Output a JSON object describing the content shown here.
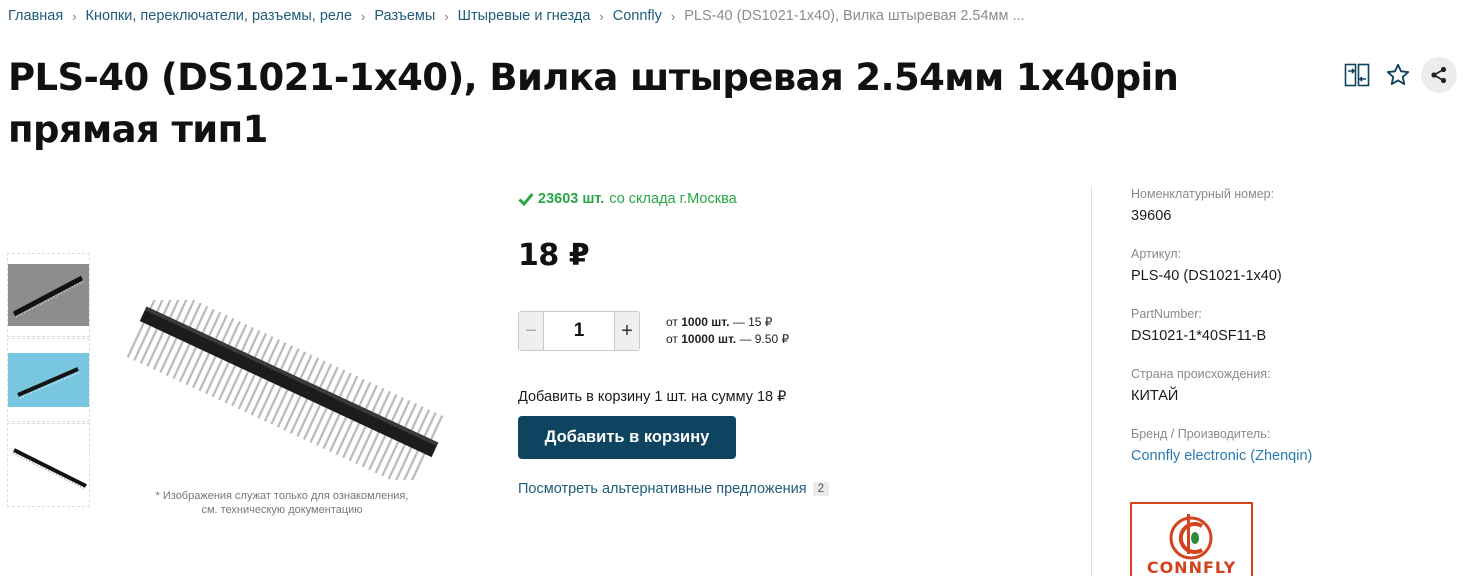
{
  "breadcrumb": {
    "items": [
      "Главная",
      "Кнопки, переключатели, разъемы, реле",
      "Разъемы",
      "Штыревые и гнезда",
      "Connfly"
    ],
    "current": "PLS-40 (DS1021-1x40), Вилка штыревая 2.54мм ..."
  },
  "product": {
    "title": "PLS-40 (DS1021-1x40), Вилка штыревая 2.54мм 1x40pin прямая тип1",
    "disclaimer_line1": "* Изображения служат только для ознакомления,",
    "disclaimer_line2": "см. техническую документацию"
  },
  "stock": {
    "count": "23603 шт.",
    "location": "со склада г.Москва"
  },
  "price": "18 ₽",
  "quantity": {
    "value": "1",
    "minus": "−",
    "plus": "+"
  },
  "tiers": [
    {
      "prefix": "от",
      "qty": "1000 шт.",
      "price": "— 15 ₽"
    },
    {
      "prefix": "от",
      "qty": "10000 шт.",
      "price": "— 9.50 ₽"
    }
  ],
  "cart": {
    "summary": "Добавить в корзину 1 шт. на сумму 18 ₽",
    "button": "Добавить в корзину"
  },
  "alternatives": {
    "label": "Посмотреть альтернативные предложения",
    "count": "2"
  },
  "specs": [
    {
      "label": "Номенклатурный номер:",
      "value": "39606"
    },
    {
      "label": "Артикул:",
      "value": "PLS-40 (DS1021-1x40)"
    },
    {
      "label": "PartNumber:",
      "value": "DS1021-1*40SF11-B"
    },
    {
      "label": "Страна происхождения:",
      "value": "КИТАЙ"
    },
    {
      "label": "Бренд / Производитель:",
      "value": "Connfly electronic (Zhenqin)"
    }
  ],
  "brand_logo_text": "CONNFLY",
  "icons": {
    "compare": "compare-icon",
    "favorite": "star-icon",
    "share": "share-icon",
    "stock": "check-icon"
  },
  "colors": {
    "primary_button": "#0f4460",
    "link": "#1f5c7a",
    "stock_green": "#28a745",
    "brand_red": "#d4421e"
  }
}
